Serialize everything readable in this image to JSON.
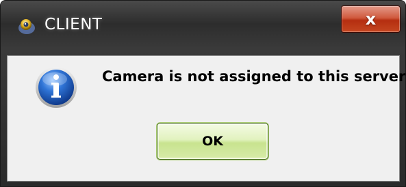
{
  "window": {
    "title": "CLIENT",
    "close_label": "x"
  },
  "dialog": {
    "message": "Camera is not assigned to this server",
    "ok_label": "OK",
    "icon": "info-icon"
  },
  "colors": {
    "titlebar": "#2d2d2d",
    "close_button": "#c44620",
    "ok_button": "#d7eba8",
    "info_icon": "#1f5fbf",
    "content_bg": "#f0f0f0"
  }
}
